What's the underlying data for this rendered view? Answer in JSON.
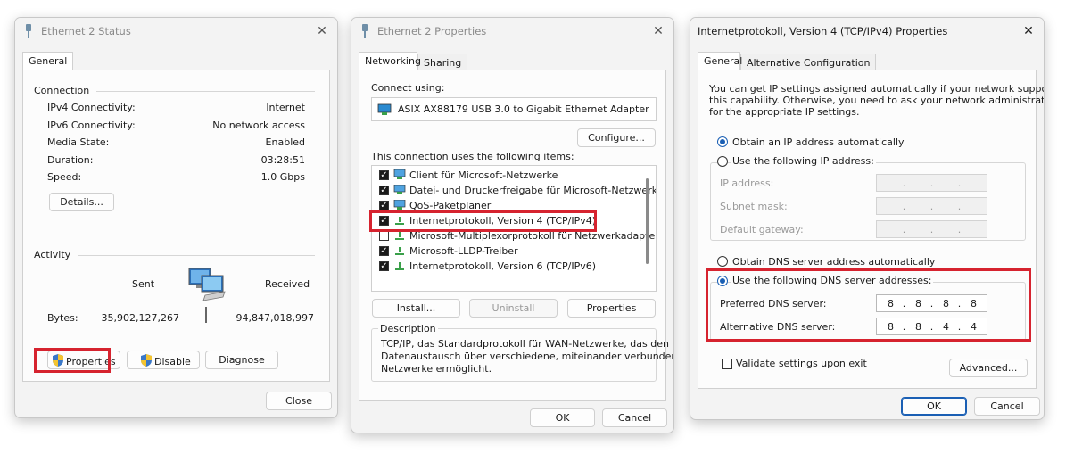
{
  "win1": {
    "title": "Ethernet 2 Status",
    "tab_general": "General",
    "connection_label": "Connection",
    "rows": [
      {
        "label": "IPv4 Connectivity:",
        "value": "Internet"
      },
      {
        "label": "IPv6 Connectivity:",
        "value": "No network access"
      },
      {
        "label": "Media State:",
        "value": "Enabled"
      },
      {
        "label": "Duration:",
        "value": "03:28:51"
      },
      {
        "label": "Speed:",
        "value": "1.0 Gbps"
      }
    ],
    "details_button": "Details...",
    "activity_label": "Activity",
    "sent_label": "Sent",
    "received_label": "Received",
    "bytes_label": "Bytes:",
    "bytes_sent": "35,902,127,267",
    "bytes_received": "94,847,018,997",
    "properties_button": "Properties",
    "disable_button": "Disable",
    "diagnose_button": "Diagnose",
    "close_button": "Close"
  },
  "win2": {
    "title": "Ethernet 2 Properties",
    "tab_networking": "Networking",
    "tab_sharing": "Sharing",
    "connect_using_label": "Connect using:",
    "adapter_name": "ASIX AX88179 USB 3.0 to Gigabit Ethernet Adapter",
    "configure_button": "Configure...",
    "items_label": "This connection uses the following items:",
    "items": [
      {
        "label": "Client für Microsoft-Netzwerke",
        "checked": true
      },
      {
        "label": "Datei- und Druckerfreigabe für Microsoft-Netzwerke",
        "checked": true
      },
      {
        "label": "QoS-Paketplaner",
        "checked": true
      },
      {
        "label": "Internetprotokoll, Version 4 (TCP/IPv4)",
        "checked": true
      },
      {
        "label": "Microsoft-Multiplexorprotokoll für Netzwerkadapter",
        "checked": false
      },
      {
        "label": "Microsoft-LLDP-Treiber",
        "checked": true
      },
      {
        "label": "Internetprotokoll, Version 6 (TCP/IPv6)",
        "checked": true
      }
    ],
    "install_button": "Install...",
    "uninstall_button": "Uninstall",
    "properties_button": "Properties",
    "description_label": "Description",
    "description_text_1": "TCP/IP, das Standardprotokoll für WAN-Netzwerke, das den",
    "description_text_2": "Datenaustausch über verschiedene, miteinander verbundene",
    "description_text_3": "Netzwerke ermöglicht.",
    "ok_button": "OK",
    "cancel_button": "Cancel"
  },
  "win3": {
    "title": "Internetprotokoll, Version 4 (TCP/IPv4) Properties",
    "tab_general": "General",
    "tab_alternative": "Alternative Configuration",
    "intro_1": "You can get IP settings assigned automatically if your network supports",
    "intro_2": "this capability. Otherwise, you need to ask your network administrator",
    "intro_3": "for the appropriate IP settings.",
    "obtain_ip_auto": "Obtain an IP address automatically",
    "use_following_ip": "Use the following IP address:",
    "ip_address_label": "IP address:",
    "subnet_mask_label": "Subnet mask:",
    "default_gateway_label": "Default gateway:",
    "obtain_dns_auto": "Obtain DNS server address automatically",
    "use_following_dns": "Use the following DNS server addresses:",
    "preferred_dns_label": "Preferred DNS server:",
    "preferred_dns": [
      "8",
      "8",
      "8",
      "8"
    ],
    "alternative_dns_label": "Alternative DNS server:",
    "alternative_dns": [
      "8",
      "8",
      "4",
      "4"
    ],
    "validate_label": "Validate settings upon exit",
    "advanced_button": "Advanced...",
    "ok_button": "OK",
    "cancel_button": "Cancel",
    "dot": "."
  },
  "colors": {
    "highlight": "#d6232f",
    "accent": "#1a5fb4"
  }
}
